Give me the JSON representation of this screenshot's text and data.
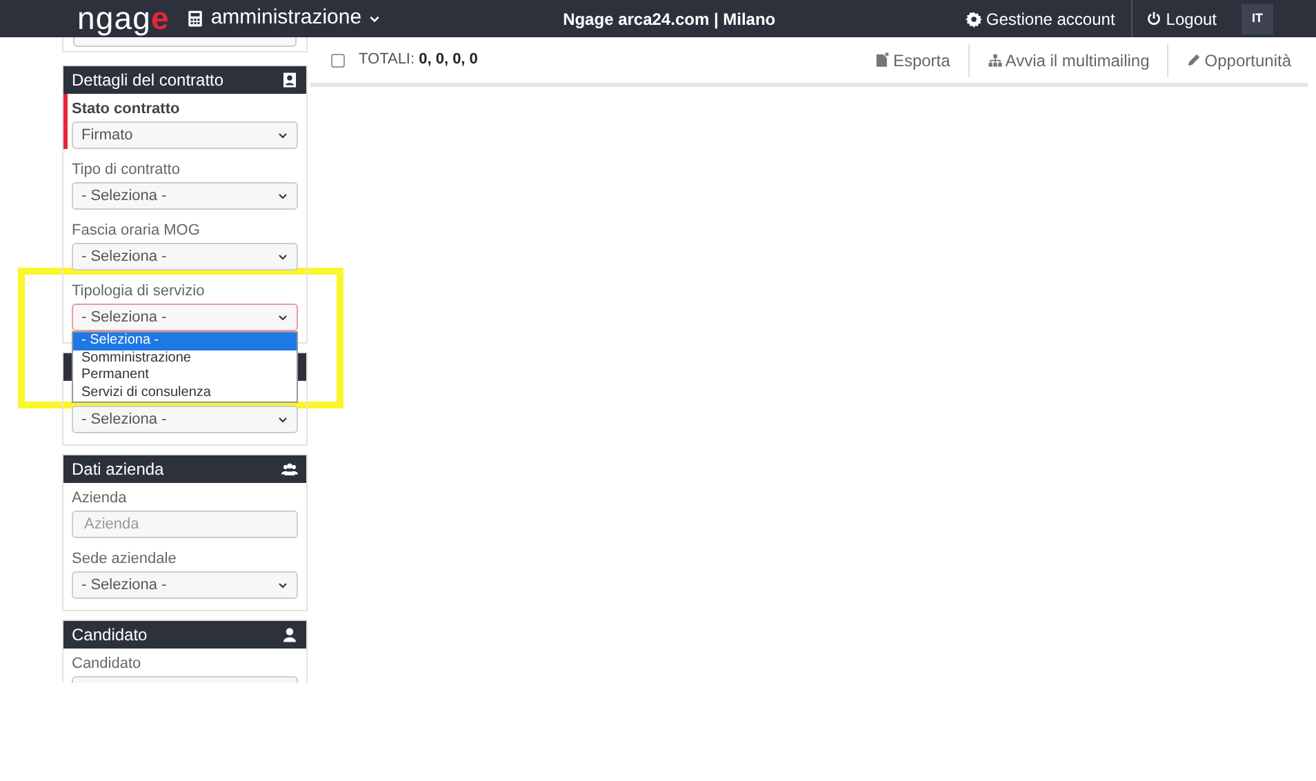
{
  "header": {
    "logo": "ngage",
    "module": "amministrazione",
    "center": "Ngage arca24.com | Milano",
    "account": "Gestione account",
    "logout": "Logout",
    "language": "IT"
  },
  "toolbar": {
    "select_all": {
      "checked": false
    },
    "totals_label": "TOTALI:",
    "totals": "0, 0, 0, 0",
    "actions": [
      {
        "kind": "export",
        "label": "Esporta"
      },
      {
        "kind": "network",
        "label": "Avvia il multimailing"
      },
      {
        "kind": "pencil",
        "label": "Opportunità"
      }
    ]
  },
  "sidebar": [
    {
      "title": "Dettagli del contratto",
      "kind": "contact",
      "fields": [
        {
          "label": "Stato contratto",
          "kind": "select",
          "value": "Firmato",
          "highlighted": true
        },
        {
          "label": "Tipo di contratto",
          "kind": "select",
          "value": "- Seleziona -",
          "highlighted": false
        },
        {
          "label": "Fascia oraria MOG",
          "kind": "select",
          "value": "- Seleziona -",
          "highlighted": false
        },
        {
          "label": "Tipologia di servizio",
          "kind": "select",
          "value": "- Seleziona -",
          "highlighted": false,
          "open": true,
          "options": [
            {
              "label": "- Seleziona -",
              "selected": true
            },
            {
              "label": "Somministrazione",
              "selected": false
            },
            {
              "label": "Permanent",
              "selected": false
            },
            {
              "label": "Servizi di consulenza",
              "selected": false
            }
          ]
        }
      ]
    },
    {
      "fields": [
        {
          "kind": "select",
          "value": "- Seleziona -",
          "highlighted": false
        }
      ]
    },
    {
      "title": "Dati azienda",
      "kind": "group",
      "fields": [
        {
          "label": "Azienda",
          "kind": "input",
          "placeholder": "Azienda",
          "highlighted": false
        },
        {
          "label": "Sede aziendale",
          "kind": "select",
          "value": "- Seleziona -",
          "highlighted": false
        }
      ]
    },
    {
      "title": "Candidato",
      "kind": "user",
      "fields": [
        {
          "label": "Candidato",
          "kind": "input",
          "highlighted": false
        }
      ]
    }
  ]
}
